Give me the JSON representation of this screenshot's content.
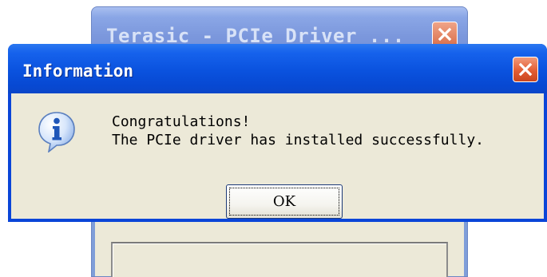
{
  "background_window": {
    "title": "Terasic - PCIe Driver ...",
    "close_glyph": "X"
  },
  "dialog": {
    "title": "Information",
    "icon": "information-icon",
    "message_line1": "Congratulations!",
    "message_line2": "The PCIe driver has installed successfully.",
    "ok_label": "OK"
  },
  "colors": {
    "titlebar_active": "#0a52de",
    "titlebar_inactive": "#7b97dc",
    "close_button": "#e35d34",
    "dialog_body": "#ece9d8"
  }
}
